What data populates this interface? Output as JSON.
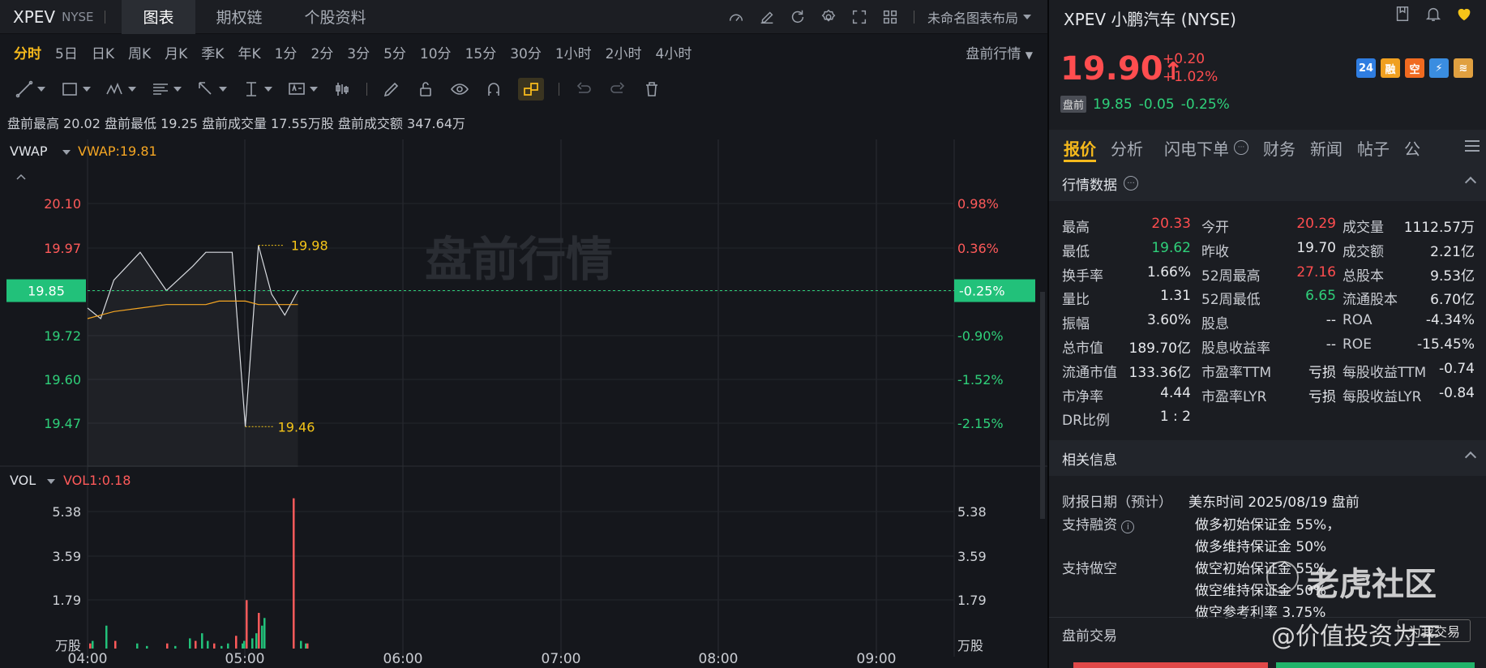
{
  "topbar": {
    "symbol": "XPEV",
    "exchange": "NYSE",
    "tabs": [
      "图表",
      "期权链",
      "个股资料"
    ],
    "layout": "未命名图表布局"
  },
  "periods": {
    "items": [
      "分时",
      "5日",
      "日K",
      "周K",
      "月K",
      "季K",
      "年K",
      "1分",
      "2分",
      "3分",
      "5分",
      "10分",
      "15分",
      "30分",
      "1小时",
      "2小时",
      "4小时"
    ],
    "active": "分时",
    "right": "盘前行情"
  },
  "stats": {
    "text": "盘前最高 20.02 盘前最低 19.25 盘前成交量 17.55万股 盘前成交额 347.64万"
  },
  "chart": {
    "vwap_label": "VWAP",
    "vwap_value": "VWAP:19.81",
    "watermark": "盘前行情",
    "hi_label": "19.98",
    "lo_label": "19.46",
    "current_price": "19.85",
    "current_pct": "-0.25%",
    "y_left": [
      "20.10",
      "19.97",
      "19.85",
      "19.72",
      "19.60",
      "19.47"
    ],
    "y_right": [
      "0.98%",
      "0.36%",
      "-0.25%",
      "-0.90%",
      "-1.52%",
      "-2.15%"
    ],
    "vol_label": "VOL",
    "vol_value": "VOL1:0.18",
    "vol_ticks": [
      "5.38",
      "3.59",
      "1.79",
      "万股"
    ],
    "x_ticks": [
      "04:00",
      "05:00",
      "06:00",
      "07:00",
      "08:00",
      "09:00"
    ]
  },
  "chart_data": {
    "type": "line",
    "title": "",
    "xlabel": "",
    "ylabel": "",
    "x_range": [
      "04:00",
      "09:00"
    ],
    "ylim": [
      19.47,
      20.1
    ],
    "series": [
      {
        "name": "",
        "x": [
          "04:00",
          "04:05",
          "04:10",
          "04:20",
          "04:30",
          "04:40",
          "04:45",
          "04:50",
          "04:55",
          "05:00",
          "05:05",
          "05:10",
          "05:15",
          "05:20"
        ],
        "values": [
          19.8,
          19.77,
          19.88,
          19.96,
          19.85,
          19.92,
          19.96,
          19.96,
          19.96,
          19.46,
          19.98,
          19.84,
          19.78,
          19.85
        ]
      },
      {
        "name": "VWAP",
        "values": [
          19.77,
          19.78,
          19.79,
          19.8,
          19.81,
          19.81,
          19.81,
          19.82,
          19.82,
          19.82,
          19.81,
          19.81,
          19.81,
          19.81
        ]
      }
    ],
    "volume": {
      "unit": "万股",
      "ylim": [
        0,
        5.38
      ],
      "values": [
        0.2,
        0.3,
        0.9,
        0.3,
        0.2,
        0.1,
        0.2,
        0.1,
        0.4,
        0.3,
        0.6,
        0.3,
        0.2,
        0.1,
        0.2,
        0.5,
        0.2,
        0.3,
        1.9,
        0.4,
        0.6,
        1.4,
        0.9,
        1.2,
        5.9,
        0.3,
        0.2,
        0.2
      ]
    }
  },
  "right": {
    "title": "XPEV 小鹏汽车 (NYSE)",
    "price": "19.90",
    "arrow": "↑",
    "chg": "+0.20",
    "pct": "+1.02%",
    "pre_badge": "盘前",
    "pre_price": "19.85",
    "pre_chg": "-0.05",
    "pre_pct": "-0.25%",
    "badges": [
      {
        "t": "24",
        "c": "#2f7de1"
      },
      {
        "t": "融",
        "c": "#f0a020"
      },
      {
        "t": "空",
        "c": "#f06a20"
      },
      {
        "t": "⚡",
        "c": "#3a8de0"
      },
      {
        "t": "≋",
        "c": "#e0a040"
      }
    ],
    "tabs": [
      "报价",
      "分析",
      "闪电下单",
      "财务",
      "新闻",
      "帖子",
      "公"
    ],
    "quote_title": "行情数据",
    "quote": [
      [
        "最高",
        "20.33",
        "red",
        "今开",
        "20.29",
        "red",
        "成交量",
        "1112.57万",
        ""
      ],
      [
        "最低",
        "19.62",
        "green",
        "昨收",
        "19.70",
        "",
        "成交额",
        "2.21亿",
        ""
      ],
      [
        "换手率",
        "1.66%",
        "",
        "52周最高",
        "27.16",
        "red",
        "总股本",
        "9.53亿",
        ""
      ],
      [
        "量比",
        "1.31",
        "",
        "52周最低",
        "6.65",
        "green",
        "流通股本",
        "6.70亿",
        ""
      ],
      [
        "振幅",
        "3.60%",
        "",
        "股息",
        "--",
        "",
        "ROA",
        "-4.34%",
        ""
      ],
      [
        "总市值",
        "189.70亿",
        "",
        "股息收益率",
        "--",
        "",
        "ROE",
        "-15.45%",
        ""
      ],
      [
        "流通市值",
        "133.36亿",
        "",
        "市盈率TTM",
        "亏损",
        "",
        "每股收益TTM",
        "-0.74",
        ""
      ],
      [
        "市净率",
        "4.44",
        "",
        "市盈率LYR",
        "亏损",
        "",
        "每股收益LYR",
        "-0.84",
        ""
      ],
      [
        "DR比例",
        "1 : 2",
        "",
        "",
        "",
        "",
        "",
        "",
        ""
      ]
    ],
    "related_title": "相关信息",
    "earn_label": "财报日期（预计）",
    "earn_value": "美东时间 2025/08/19 盘前",
    "margin_label": "支持融资",
    "margin_1": "做多初始保证金 55%，",
    "margin_2": "做多维持保证金 50%",
    "short_label": "支持做空",
    "short_1": "做空初始保证金 55%",
    "short_2": "做空维持保证金 50%",
    "short_3": "做空参考利率 3.75%",
    "pre_trade": "盘前交易",
    "pre_trade_btn": "为我交易",
    "wm1": "老虎社区",
    "wm2": "@价值投资为王"
  }
}
